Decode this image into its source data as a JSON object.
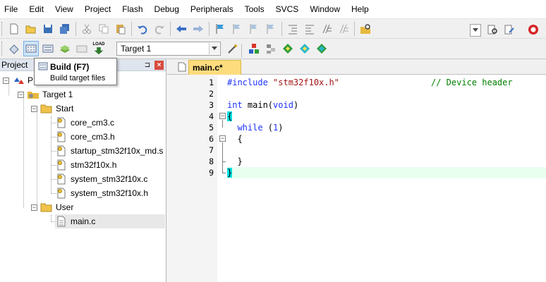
{
  "menu": [
    "File",
    "Edit",
    "View",
    "Project",
    "Flash",
    "Debug",
    "Peripherals",
    "Tools",
    "SVCS",
    "Window",
    "Help"
  ],
  "toolbar2": {
    "load_label": "LOAD",
    "target_value": "Target 1"
  },
  "tooltip": {
    "title": "Build (F7)",
    "description": "Build target files"
  },
  "project_pane": {
    "title": "Project",
    "pin_glyph": "⊐",
    "close_glyph": "×"
  },
  "tree": {
    "root": "P",
    "target": "Target 1",
    "group_start": "Start",
    "start_files": [
      "core_cm3.c",
      "core_cm3.h",
      "startup_stm32f10x_md.s",
      "stm32f10x.h",
      "system_stm32f10x.c",
      "system_stm32f10x.h"
    ],
    "group_user": "User",
    "user_files": [
      "main.c"
    ]
  },
  "editor": {
    "tab_label": "main.c*",
    "line_numbers": [
      "1",
      "2",
      "3",
      "4",
      "5",
      "6",
      "7",
      "8",
      "9"
    ],
    "code": {
      "l1_directive": "#include",
      "l1_string": "\"stm32f10x.h\"",
      "l1_comment": "// Device header",
      "l3_type": "int",
      "l3_name": " main(",
      "l3_void": "void",
      "l3_close": ")",
      "l4": "{",
      "l5_kw": "while",
      "l5_open": " (",
      "l5_num": "1",
      "l5_close": ")",
      "l6": "{",
      "l8": "}",
      "l9": "}"
    }
  },
  "colors": {
    "tab_active": "#fddc7e",
    "keyword": "#1f32ff",
    "string": "#a31515",
    "comment": "#008000",
    "current_line": "#e8fff0"
  }
}
